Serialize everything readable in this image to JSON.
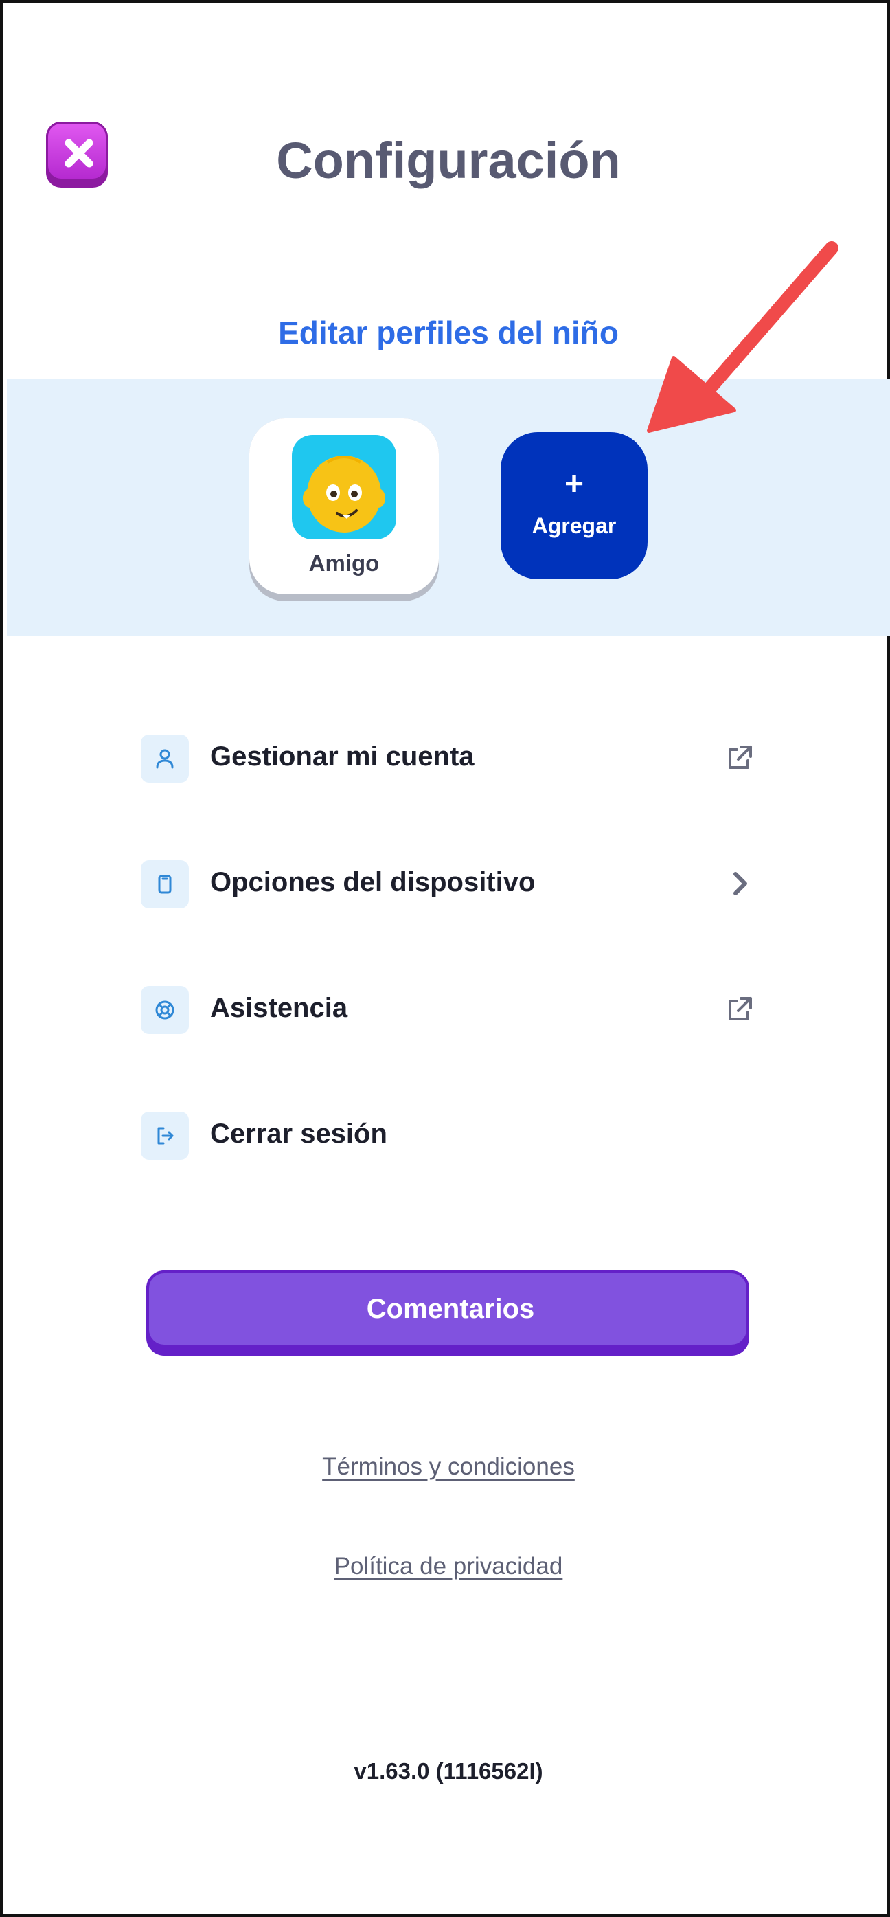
{
  "header": {
    "title": "Configuración",
    "close_icon": "close-icon"
  },
  "profiles": {
    "section_title": "Editar perfiles del niño",
    "items": [
      {
        "name": "Amigo",
        "avatar_color": "#1fc7ef"
      }
    ],
    "add": {
      "symbol": "+",
      "label": "Agregar"
    }
  },
  "menu": [
    {
      "label": "Gestionar mi cuenta",
      "icon": "user-icon",
      "trail": "external-link-icon"
    },
    {
      "label": "Opciones del dispositivo",
      "icon": "device-icon",
      "trail": "chevron-right-icon"
    },
    {
      "label": "Asistencia",
      "icon": "lifebuoy-icon",
      "trail": "external-link-icon"
    },
    {
      "label": "Cerrar sesión",
      "icon": "logout-icon",
      "trail": ""
    }
  ],
  "feedback_button": {
    "label": "Comentarios"
  },
  "links": {
    "terms": "Términos y condiciones",
    "privacy": "Política de privacidad"
  },
  "version": "v1.63.0 (1116562I)",
  "colors": {
    "title": "#585a72",
    "accent_blue": "#2e6ce6",
    "add_button": "#0033bb",
    "feedback_button": "#8152df",
    "close_button": "#c23bd9",
    "band": "#e4f1fc",
    "annotation_arrow": "#f04a4a"
  }
}
